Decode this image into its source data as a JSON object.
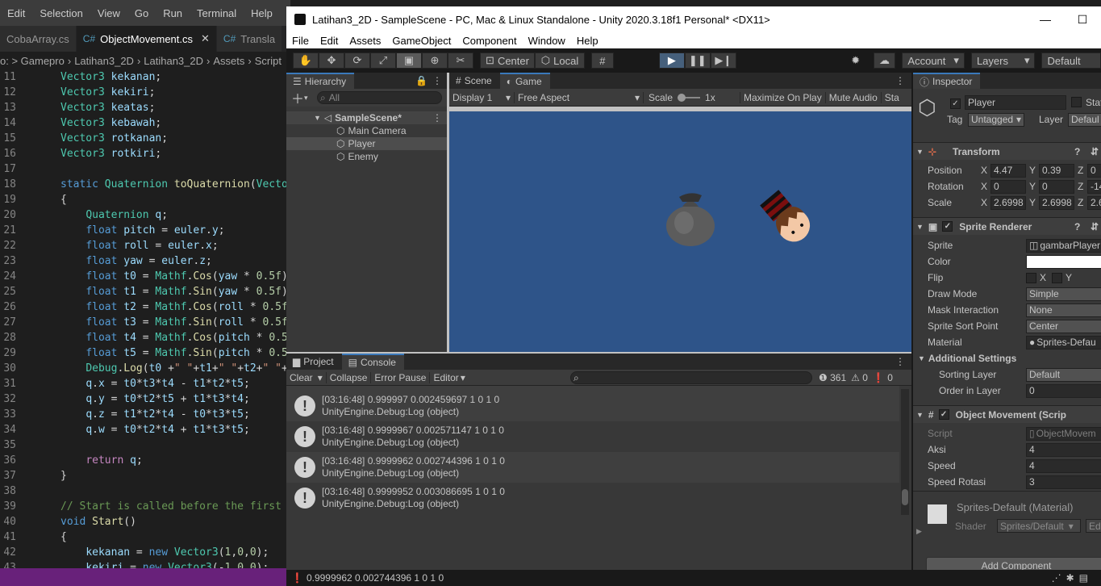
{
  "vscode": {
    "menu": [
      "Edit",
      "Selection",
      "View",
      "Go",
      "Run",
      "Terminal",
      "Help"
    ],
    "tabs": [
      {
        "label": "CobaArray.cs"
      },
      {
        "label": "ObjectMovement.cs"
      },
      {
        "label": "Transla"
      }
    ],
    "breadcrumb": [
      "o: > Gamepro",
      "Latihan3_2D",
      "Latihan3_2D",
      "Assets",
      "Script"
    ],
    "lines": [
      {
        "n": "11",
        "html": "<span class='ty'>Vector3</span> <span class='vr'>kekanan</span>;"
      },
      {
        "n": "12",
        "html": "<span class='ty'>Vector3</span> <span class='vr'>kekiri</span>;"
      },
      {
        "n": "13",
        "html": "<span class='ty'>Vector3</span> <span class='vr'>keatas</span>;"
      },
      {
        "n": "14",
        "html": "<span class='ty'>Vector3</span> <span class='vr'>kebawah</span>;"
      },
      {
        "n": "15",
        "html": "<span class='ty'>Vector3</span> <span class='vr'>rotkanan</span>;"
      },
      {
        "n": "16",
        "html": "<span class='ty'>Vector3</span> <span class='vr'>rotkiri</span>;"
      },
      {
        "n": "17",
        "html": ""
      },
      {
        "n": "18",
        "html": "<span class='kw'>static</span> <span class='ty'>Quaternion</span> <span class='fn'>toQuaternion</span>(<span class='ty'>Vector</span>"
      },
      {
        "n": "19",
        "html": "{"
      },
      {
        "n": "20",
        "html": "    <span class='ty'>Quaternion</span> <span class='vr'>q</span>;"
      },
      {
        "n": "21",
        "html": "    <span class='kw'>float</span> <span class='vr'>pitch</span> = <span class='vr'>euler</span>.<span class='vr'>y</span>;"
      },
      {
        "n": "22",
        "html": "    <span class='kw'>float</span> <span class='vr'>roll</span> = <span class='vr'>euler</span>.<span class='vr'>x</span>;"
      },
      {
        "n": "23",
        "html": "    <span class='kw'>float</span> <span class='vr'>yaw</span> = <span class='vr'>euler</span>.<span class='vr'>z</span>;"
      },
      {
        "n": "24",
        "html": "    <span class='kw'>float</span> <span class='vr'>t0</span> = <span class='ty'>Mathf</span>.<span class='fn'>Cos</span>(<span class='vr'>yaw</span> * <span class='nm'>0.5f</span>)"
      },
      {
        "n": "25",
        "html": "    <span class='kw'>float</span> <span class='vr'>t1</span> = <span class='ty'>Mathf</span>.<span class='fn'>Sin</span>(<span class='vr'>yaw</span> * <span class='nm'>0.5f</span>)"
      },
      {
        "n": "26",
        "html": "    <span class='kw'>float</span> <span class='vr'>t2</span> = <span class='ty'>Mathf</span>.<span class='fn'>Cos</span>(<span class='vr'>roll</span> * <span class='nm'>0.5f</span>"
      },
      {
        "n": "27",
        "html": "    <span class='kw'>float</span> <span class='vr'>t3</span> = <span class='ty'>Mathf</span>.<span class='fn'>Sin</span>(<span class='vr'>roll</span> * <span class='nm'>0.5f</span>"
      },
      {
        "n": "28",
        "html": "    <span class='kw'>float</span> <span class='vr'>t4</span> = <span class='ty'>Mathf</span>.<span class='fn'>Cos</span>(<span class='vr'>pitch</span> * <span class='nm'>0.5</span>"
      },
      {
        "n": "29",
        "html": "    <span class='kw'>float</span> <span class='vr'>t5</span> = <span class='ty'>Mathf</span>.<span class='fn'>Sin</span>(<span class='vr'>pitch</span> * <span class='nm'>0.5</span>"
      },
      {
        "n": "30",
        "html": "    <span class='ty'>Debug</span>.<span class='fn'>Log</span>(<span class='vr'>t0</span> +<span class='st'>\" \"</span>+<span class='vr'>t1</span>+<span class='st'>\" \"</span>+<span class='vr'>t2</span>+<span class='st'>\" \"</span>+"
      },
      {
        "n": "31",
        "html": "    <span class='vr'>q</span>.<span class='vr'>x</span> = <span class='vr'>t0</span>*<span class='vr'>t3</span>*<span class='vr'>t4</span> - <span class='vr'>t1</span>*<span class='vr'>t2</span>*<span class='vr'>t5</span>;"
      },
      {
        "n": "32",
        "html": "    <span class='vr'>q</span>.<span class='vr'>y</span> = <span class='vr'>t0</span>*<span class='vr'>t2</span>*<span class='vr'>t5</span> + <span class='vr'>t1</span>*<span class='vr'>t3</span>*<span class='vr'>t4</span>;"
      },
      {
        "n": "33",
        "html": "    <span class='vr'>q</span>.<span class='vr'>z</span> = <span class='vr'>t1</span>*<span class='vr'>t2</span>*<span class='vr'>t4</span> - <span class='vr'>t0</span>*<span class='vr'>t3</span>*<span class='vr'>t5</span>;"
      },
      {
        "n": "34",
        "html": "    <span class='vr'>q</span>.<span class='vr'>w</span> = <span class='vr'>t0</span>*<span class='vr'>t2</span>*<span class='vr'>t4</span> + <span class='vr'>t1</span>*<span class='vr'>t3</span>*<span class='vr'>t5</span>;"
      },
      {
        "n": "35",
        "html": ""
      },
      {
        "n": "36",
        "html": "    <span class='ctl'>return</span> <span class='vr'>q</span>;"
      },
      {
        "n": "37",
        "html": "}"
      },
      {
        "n": "38",
        "html": ""
      },
      {
        "n": "39",
        "html": "<span class='cm'>// Start is called before the first </span>"
      },
      {
        "n": "40",
        "html": "<span class='kw'>void</span> <span class='fn'>Start</span>()"
      },
      {
        "n": "41",
        "html": "{"
      },
      {
        "n": "42",
        "html": "    <span class='vr'>kekanan</span> = <span class='kw'>new</span> <span class='ty'>Vector3</span>(<span class='nm'>1</span>,<span class='nm'>0</span>,<span class='nm'>0</span>);"
      },
      {
        "n": "43",
        "html": "    <span class='vr'>kekiri</span> = <span class='kw'>new</span> <span class='ty'>Vector3</span>(-<span class='nm'>1</span>,<span class='nm'>0</span>,<span class='nm'>0</span>);"
      }
    ]
  },
  "unity": {
    "title": "Latihan3_2D - SampleScene - PC, Mac & Linux Standalone - Unity 2020.3.18f1 Personal* <DX11>",
    "menu": [
      "File",
      "Edit",
      "Assets",
      "GameObject",
      "Component",
      "Window",
      "Help"
    ],
    "toolbar": {
      "center": "Center",
      "local": "Local",
      "account": "Account",
      "layers": "Layers",
      "layout": "Default"
    },
    "hierarchy": {
      "tab": "Hierarchy",
      "search": "All",
      "scene": "SampleScene*",
      "items": [
        "Main Camera",
        "Player",
        "Enemy"
      ]
    },
    "game": {
      "tab_scene": "Scene",
      "tab_game": "Game",
      "display": "Display 1",
      "aspect": "Free Aspect",
      "scale_label": "Scale",
      "scale_value": "1x",
      "maximize": "Maximize On Play",
      "mute": "Mute Audio",
      "stats": "Sta"
    },
    "console": {
      "tab_project": "Project",
      "tab_console": "Console",
      "clear": "Clear",
      "collapse": "Collapse",
      "error_pause": "Error Pause",
      "editor": "Editor",
      "count_log": "361",
      "count_warn": "0",
      "count_err": "0",
      "entries": [
        {
          "line1": "[03:16:48] 0.999997 0.002459697 1 0 1 0",
          "line2": "UnityEngine.Debug:Log (object)"
        },
        {
          "line1": "[03:16:48] 0.9999967 0.002571147 1 0 1 0",
          "line2": "UnityEngine.Debug:Log (object)"
        },
        {
          "line1": "[03:16:48] 0.9999962 0.002744396 1 0 1 0",
          "line2": "UnityEngine.Debug:Log (object)"
        },
        {
          "line1": "[03:16:48] 0.9999952 0.003086695 1 0 1 0",
          "line2": "UnityEngine.Debug:Log (object)"
        }
      ]
    },
    "inspector": {
      "tab": "Inspector",
      "object_name": "Player",
      "static": "Stat",
      "tag_label": "Tag",
      "tag": "Untagged",
      "layer_label": "Layer",
      "layer": "Defaul",
      "transform": {
        "title": "Transform",
        "position": "Position",
        "rotation": "Rotation",
        "scale": "Scale",
        "pos": [
          "4.47",
          "0.39",
          "0"
        ],
        "rot": [
          "0",
          "0",
          "-14"
        ],
        "scl": [
          "2.6998",
          "2.6998",
          "2.6"
        ]
      },
      "sprite_renderer": {
        "title": "Sprite Renderer",
        "sprite_label": "Sprite",
        "sprite": "gambarPlayer",
        "color_label": "Color",
        "flip_label": "Flip",
        "flip_x": "X",
        "flip_y": "Y",
        "draw_mode_label": "Draw Mode",
        "draw_mode": "Simple",
        "mask_label": "Mask Interaction",
        "mask": "None",
        "sort_point_label": "Sprite Sort Point",
        "sort_point": "Center",
        "material_label": "Material",
        "material": "Sprites-Defau",
        "additional": "Additional Settings",
        "sorting_layer_label": "Sorting Layer",
        "sorting_layer": "Default",
        "order_label": "Order in Layer",
        "order": "0"
      },
      "object_movement": {
        "title": "Object Movement (Scrip",
        "script_label": "Script",
        "script": "ObjectMovem",
        "aksi_label": "Aksi",
        "aksi": "4",
        "speed_label": "Speed",
        "speed": "4",
        "rot_label": "Speed Rotasi",
        "rot": "3"
      },
      "material": {
        "name": "Sprites-Default (Material)",
        "shader_label": "Shader",
        "shader": "Sprites/Default",
        "edit": "Ed"
      },
      "add_component": "Add Component"
    },
    "status": "0.9999962 0.002744396 1 0 1 0"
  }
}
